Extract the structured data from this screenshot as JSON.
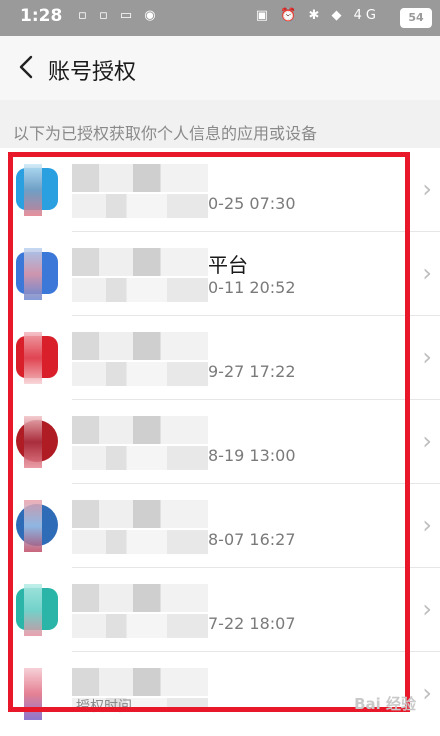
{
  "status_bar": {
    "time": "1:28",
    "left_icons": "▫ ▫ ▭ ◉",
    "right_icons": "▣ ⏰ ✱ ◆ 4G",
    "battery": "54"
  },
  "header": {
    "back_icon": "chevron-left",
    "title": "账号授权"
  },
  "subtitle": "以下为已授权获取你个人信息的应用或设备",
  "rows": [
    {
      "name_tail": "",
      "time": "0-25 07:30",
      "icon_color": "#2aa0e0"
    },
    {
      "name_tail": "平台",
      "time": "0-11 20:52",
      "icon_color": "#3b78d8"
    },
    {
      "name_tail": "",
      "time": "9-27 17:22",
      "icon_color": "#d9202a"
    },
    {
      "name_tail": "",
      "time": "8-19 13:00",
      "icon_color": "#b01c24"
    },
    {
      "name_tail": "",
      "time": "8-07 16:27",
      "icon_color": "#2f6cb8"
    },
    {
      "name_tail": "",
      "time": "7-22 18:07",
      "icon_color": "#2bb5a8"
    },
    {
      "name_tail": "",
      "time": "",
      "icon_color": "#5a3fb0"
    }
  ],
  "last_row_label": "授权时间",
  "watermark": "Bai 经验",
  "highlight_color": "#e8182a"
}
